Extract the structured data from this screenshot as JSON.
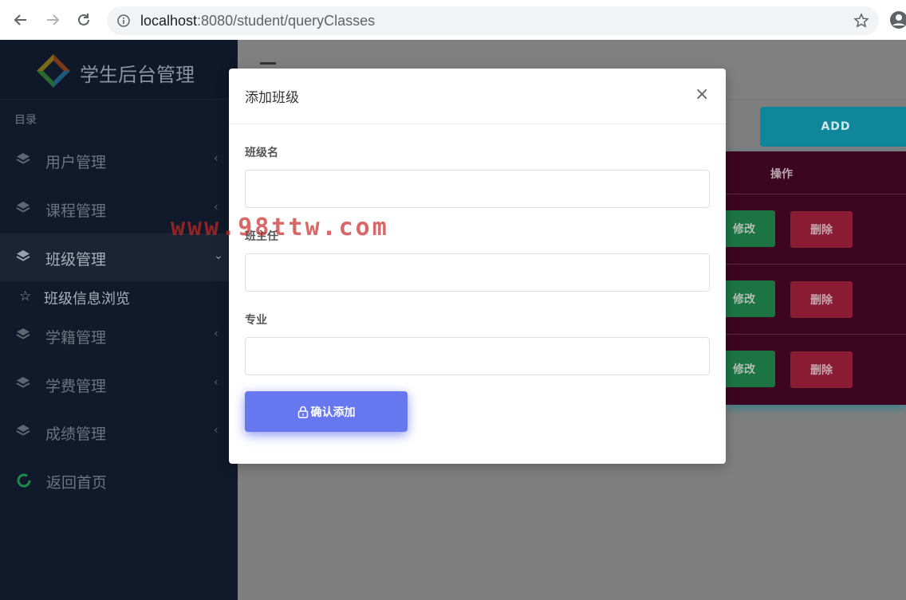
{
  "browser": {
    "url_host": "localhost",
    "url_path": ":8080/student/queryClasses"
  },
  "sidebar": {
    "brand_title": "学生后台管理",
    "menu_header": "目录",
    "items": [
      {
        "label": "用户管理",
        "icon": "layers-icon"
      },
      {
        "label": "课程管理",
        "icon": "layers-icon"
      },
      {
        "label": "班级管理",
        "icon": "layers-icon",
        "active": true
      },
      {
        "label": "学籍管理",
        "icon": "layers-icon"
      },
      {
        "label": "学费管理",
        "icon": "layers-icon"
      },
      {
        "label": "成绩管理",
        "icon": "layers-icon"
      },
      {
        "label": "返回首页",
        "icon": "refresh-circle-icon"
      }
    ],
    "sub_item": {
      "label": "班级信息浏览",
      "icon": "star-outline-icon"
    }
  },
  "main": {
    "add_label": "ADD",
    "table_header_op": "操作",
    "rows": [
      {
        "edit": "修改",
        "delete": "删除"
      },
      {
        "edit": "修改",
        "delete": "删除"
      },
      {
        "edit": "修改",
        "delete": "删除"
      }
    ]
  },
  "modal": {
    "title": "添加班级",
    "close": "×",
    "fields": [
      {
        "label": "班级名",
        "value": ""
      },
      {
        "label": "班主任",
        "value": ""
      },
      {
        "label": "专业",
        "value": ""
      }
    ],
    "confirm_label": "确认添加"
  },
  "watermark": "www.98ttw.com",
  "colors": {
    "primary": "#6777ef",
    "sidebar": "#111a2a",
    "success": "#1c7443",
    "danger": "#8a1d34",
    "info": "#0f8699"
  }
}
